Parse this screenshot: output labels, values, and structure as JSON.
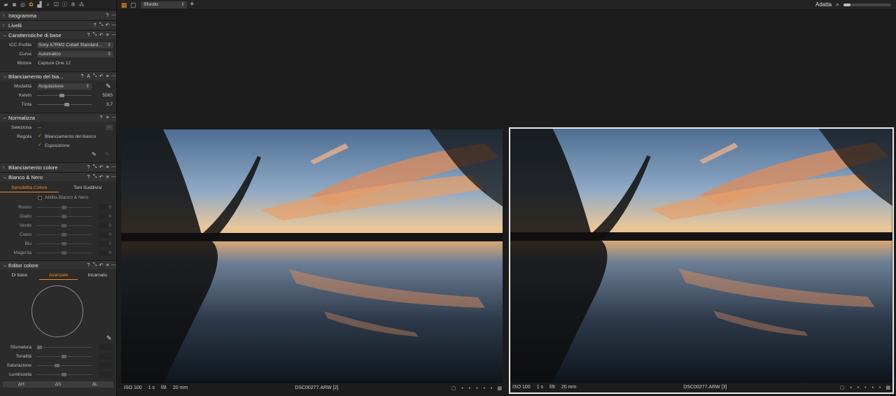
{
  "sidebar": {
    "panels": {
      "istogramma": {
        "title": "Istogramma"
      },
      "livelli": {
        "title": "Livelli"
      },
      "base": {
        "title": "Caratteristiche di base",
        "icc_label": "ICC Profile",
        "icc_value": "Sony A7RM2 Cobalt Standard...",
        "curve_label": "Curve",
        "curve_value": "Automatico",
        "motore_label": "Motore",
        "motore_value": "Capture One 12"
      },
      "wb": {
        "title": "Bilanciamento del bia...",
        "mode_label": "Modalità",
        "mode_value": "Acquisizione",
        "kelvin_label": "Kelvin",
        "kelvin_value": "5565",
        "kelvin_level": 0.45,
        "tint_label": "Tinta",
        "tint_value": "3,7",
        "tint_level": 0.55
      },
      "norm": {
        "title": "Normalizza",
        "sel_label": "Seleziona",
        "sel_value": "--",
        "reg_label": "Regola",
        "opt1": "Bilanciamento del bianco",
        "opt2": "Esposizione"
      },
      "colbal": {
        "title": "Bilanciamento colore"
      },
      "bw": {
        "title": "Bianco & Nero",
        "tab1": "Sensibilità Colore",
        "tab2": "Toni Suddivisi",
        "enable": "Abilita Bianco & Nero",
        "sliders": [
          {
            "label": "Rosso",
            "value": "0"
          },
          {
            "label": "Giallo",
            "value": "0"
          },
          {
            "label": "Verde",
            "value": "0"
          },
          {
            "label": "Ciano",
            "value": "0"
          },
          {
            "label": "Blu",
            "value": "0"
          },
          {
            "label": "Magenta",
            "value": "0"
          }
        ]
      },
      "coled": {
        "title": "Editor colore",
        "tab1": "Di base",
        "tab2": "Avanzate",
        "tab3": "Incarnato",
        "sliders": [
          {
            "label": "Sfumatura",
            "level": 0.0
          },
          {
            "label": "Tonalità",
            "level": 0.5
          },
          {
            "label": "Saturazione",
            "level": 0.35
          },
          {
            "label": "Luminosità",
            "level": 0.5
          }
        ],
        "btn1": "ΔH",
        "btn2": "ΔS",
        "btn3": "ΔL"
      }
    },
    "icons": {
      "help": "?",
      "more": "⋯",
      "auto": "A"
    }
  },
  "toolbar": {
    "background_select": "Sfondo",
    "fit_label": "Adatta",
    "zoom_level": 0.15
  },
  "viewers": [
    {
      "iso": "ISO 100",
      "shutter": "1 s",
      "aperture": "f/8",
      "focal": "20 mm",
      "filename": "DSC00277.ARW [2]"
    },
    {
      "iso": "ISO 100",
      "shutter": "1 s",
      "aperture": "f/8",
      "focal": "20 mm",
      "filename": "DSC00277.ARW [3]"
    }
  ],
  "colors": {
    "accent": "#f08a24",
    "panel": "#2b2b2b",
    "header": "#333333"
  }
}
